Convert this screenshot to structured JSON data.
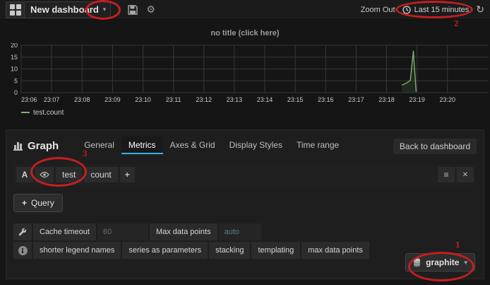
{
  "topbar": {
    "dashboard_title": "New dashboard",
    "zoom_out_label": "Zoom Out",
    "time_range_label": "Last 15 minutes"
  },
  "icons": {
    "caret_down": "▾",
    "gear": "⚙",
    "refresh": "↻",
    "hamburger": "≡",
    "close": "✕",
    "plus": "+"
  },
  "chart_data": {
    "type": "line",
    "title": "no title (click here)",
    "x_ticks": [
      "23:06",
      "23:07",
      "23:08",
      "23:09",
      "23:10",
      "23:11",
      "23:12",
      "23:13",
      "23:14",
      "23:15",
      "23:16",
      "23:17",
      "23:18",
      "23:19",
      "23:20"
    ],
    "y_ticks": [
      0,
      5,
      10,
      15,
      20
    ],
    "xlim": [
      0,
      15.35
    ],
    "ylim": [
      0,
      20
    ],
    "grid": true,
    "legend_position": "bottom-left",
    "series": [
      {
        "name": "test.count",
        "color": "#7eb26d",
        "points": [
          [
            12.5,
            3.2
          ],
          [
            12.65,
            4.0
          ],
          [
            12.78,
            5.2
          ],
          [
            12.88,
            17.5
          ],
          [
            12.97,
            0.4
          ]
        ]
      }
    ]
  },
  "editor": {
    "panel_type_label": "Graph",
    "tabs": [
      {
        "label": "General",
        "active": false
      },
      {
        "label": "Metrics",
        "active": true
      },
      {
        "label": "Axes & Grid",
        "active": false
      },
      {
        "label": "Display Styles",
        "active": false
      },
      {
        "label": "Time range",
        "active": false
      }
    ],
    "back_label": "Back to dashboard",
    "query": {
      "row_label": "A",
      "segments": [
        "test",
        "count"
      ]
    },
    "add_query_label": "Query",
    "options": {
      "cache_timeout_label": "Cache timeout",
      "cache_timeout_placeholder": "60",
      "max_data_points_label": "Max data points",
      "max_data_points_placeholder": "auto"
    },
    "info_links": [
      "shorter legend names",
      "series as parameters",
      "stacking",
      "templating",
      "max data points"
    ],
    "datasource_label": "graphite"
  },
  "annotations": {
    "step1": "1",
    "step2": "2",
    "step3": "3"
  },
  "colors": {
    "series_green": "#7eb26d",
    "active_tab_blue": "#33b5e5",
    "annotation_red": "#c41f1f",
    "grid_line": "#383838",
    "axis_text": "#c8c8c8"
  }
}
